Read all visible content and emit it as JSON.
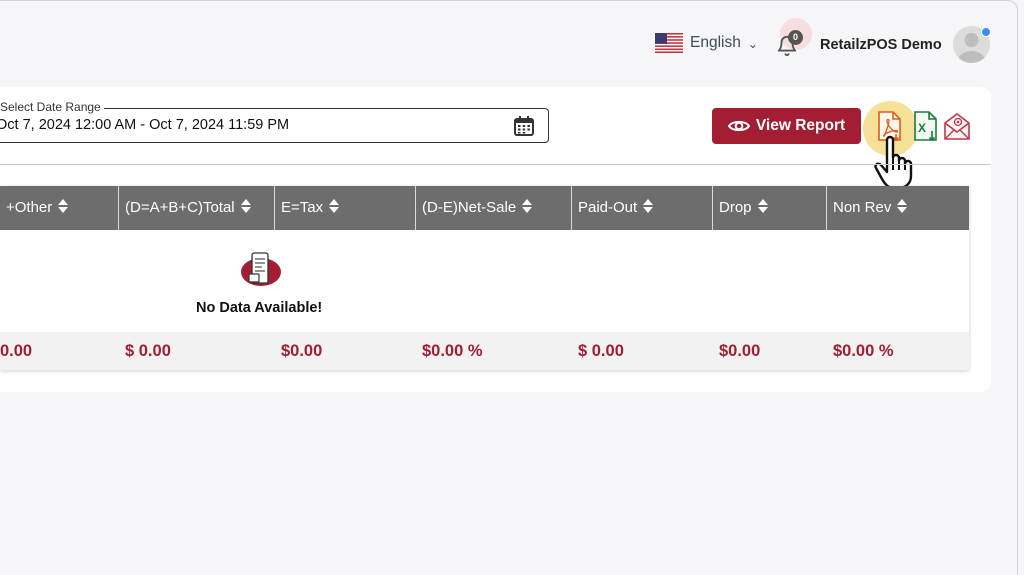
{
  "header": {
    "language": "English",
    "notification_count": "0",
    "user_name": "RetailzPOS Demo"
  },
  "filters": {
    "date_range_label": "Select Date Range",
    "date_range_value": "Oct 7, 2024 12:00 AM - Oct 7, 2024 11:59 PM",
    "view_report_label": "View Report"
  },
  "table": {
    "headers": [
      "+Other",
      "(D=A+B+C)Total",
      "E=Tax",
      "(D-E)Net-Sale",
      "Paid-Out",
      "Drop",
      "Non Rev"
    ],
    "empty_message": "No Data Available!",
    "totals": [
      "0.00",
      "$ 0.00",
      "$0.00",
      "$0.00 %",
      "$ 0.00",
      "$0.00",
      "$0.00 %"
    ]
  },
  "colors": {
    "accent": "#a31d33",
    "table_header": "#6d6d6d",
    "pdf": "#e05a1c",
    "excel": "#1e7a3a",
    "mail": "#c0374a"
  },
  "icons": {
    "language": "us-flag-icon",
    "notifications": "bell-icon",
    "calendar": "calendar-icon",
    "view": "eye-icon",
    "export_pdf": "pdf-export-icon",
    "export_excel": "excel-export-icon",
    "export_email": "email-export-icon",
    "cursor": "hand-cursor-icon"
  }
}
